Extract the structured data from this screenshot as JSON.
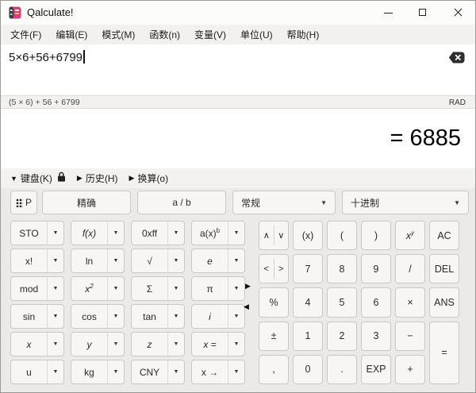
{
  "window": {
    "title": "Qalculate!"
  },
  "menubar": {
    "items": [
      "文件(F)",
      "编辑(E)",
      "模式(M)",
      "函数(n)",
      "变量(V)",
      "单位(U)",
      "帮助(H)"
    ]
  },
  "input": {
    "value": "5×6+56+6799"
  },
  "status": {
    "parsed": "(5 × 6) + 56 + 6799",
    "angle_mode": "RAD"
  },
  "result": {
    "display": "= 6885"
  },
  "panels": {
    "keyboard": "键盘(K)",
    "history": "历史(H)",
    "convert": "换算(o)"
  },
  "keypad_controls": {
    "p_label": "P",
    "exact": "精确",
    "fraction": "a / b",
    "output_mode": "常规",
    "base": "十进制"
  },
  "icons": {
    "dropdown": "▼",
    "expanded": "▼",
    "collapsed": "▶",
    "handle_expand": "▶",
    "handle_collapse": "◀"
  },
  "colors": {
    "accent_logo": "#e23a7a",
    "button_bg": "#f7f6f4",
    "button_border": "#c9c8c4",
    "keypad_bg": "#ebeae8",
    "bar_bg": "#f2f1ef"
  },
  "left_keypad": {
    "keys": [
      {
        "name": "sto",
        "label": "STO"
      },
      {
        "name": "function",
        "label": "f(x)",
        "italic": true
      },
      {
        "name": "hex-base",
        "label": "0xff"
      },
      {
        "name": "named-function",
        "label": "a(x)",
        "sup": "b"
      },
      {
        "name": "factorial",
        "label": "x!"
      },
      {
        "name": "ln",
        "label": "ln"
      },
      {
        "name": "sqrt",
        "label": "√"
      },
      {
        "name": "e-constant",
        "label": "e",
        "italic": true
      },
      {
        "name": "mod",
        "label": "mod"
      },
      {
        "name": "square",
        "label": "x",
        "sup": "2",
        "italic": true
      },
      {
        "name": "sum",
        "label": "Σ"
      },
      {
        "name": "pi",
        "label": "π"
      },
      {
        "name": "sin",
        "label": "sin"
      },
      {
        "name": "cos",
        "label": "cos"
      },
      {
        "name": "tan",
        "label": "tan"
      },
      {
        "name": "imaginary-i",
        "label": "i",
        "italic": true
      },
      {
        "name": "var-x",
        "label": "x",
        "italic": true
      },
      {
        "name": "var-y",
        "label": "y",
        "italic": true
      },
      {
        "name": "var-z",
        "label": "z",
        "italic": true
      },
      {
        "name": "x-equals",
        "label": "x =",
        "italic": true
      },
      {
        "name": "unit-u",
        "label": "u"
      },
      {
        "name": "unit-kg",
        "label": "kg"
      },
      {
        "name": "currency-cny",
        "label": "CNY"
      },
      {
        "name": "convert-to",
        "label": "x →"
      }
    ]
  },
  "right_keypad": {
    "keys": [
      {
        "name": "up-down",
        "type": "split",
        "left": "∧",
        "right": "∨"
      },
      {
        "name": "smart-parentheses",
        "label": "(x)"
      },
      {
        "name": "left-paren",
        "label": "("
      },
      {
        "name": "right-paren",
        "label": ")"
      },
      {
        "name": "power",
        "label": "x",
        "sup": "y",
        "italic": true
      },
      {
        "name": "ac",
        "label": "AC"
      },
      {
        "name": "left-right",
        "type": "split",
        "left": "<",
        "right": ">"
      },
      {
        "name": "digit-7",
        "label": "7"
      },
      {
        "name": "digit-8",
        "label": "8"
      },
      {
        "name": "digit-9",
        "label": "9"
      },
      {
        "name": "divide",
        "label": "/"
      },
      {
        "name": "del",
        "label": "DEL"
      },
      {
        "name": "percent",
        "label": "%"
      },
      {
        "name": "digit-4",
        "label": "4"
      },
      {
        "name": "digit-5",
        "label": "5"
      },
      {
        "name": "digit-6",
        "label": "6"
      },
      {
        "name": "multiply",
        "label": "×"
      },
      {
        "name": "ans",
        "label": "ANS"
      },
      {
        "name": "plus-minus",
        "label": "±"
      },
      {
        "name": "digit-1",
        "label": "1"
      },
      {
        "name": "digit-2",
        "label": "2"
      },
      {
        "name": "digit-3",
        "label": "3"
      },
      {
        "name": "minus",
        "label": "−"
      },
      {
        "name": "equals",
        "label": "=",
        "tall": true
      },
      {
        "name": "comma",
        "label": ","
      },
      {
        "name": "digit-0",
        "label": "0"
      },
      {
        "name": "dot",
        "label": "."
      },
      {
        "name": "exp",
        "label": "EXP"
      },
      {
        "name": "plus",
        "label": "+"
      }
    ]
  }
}
